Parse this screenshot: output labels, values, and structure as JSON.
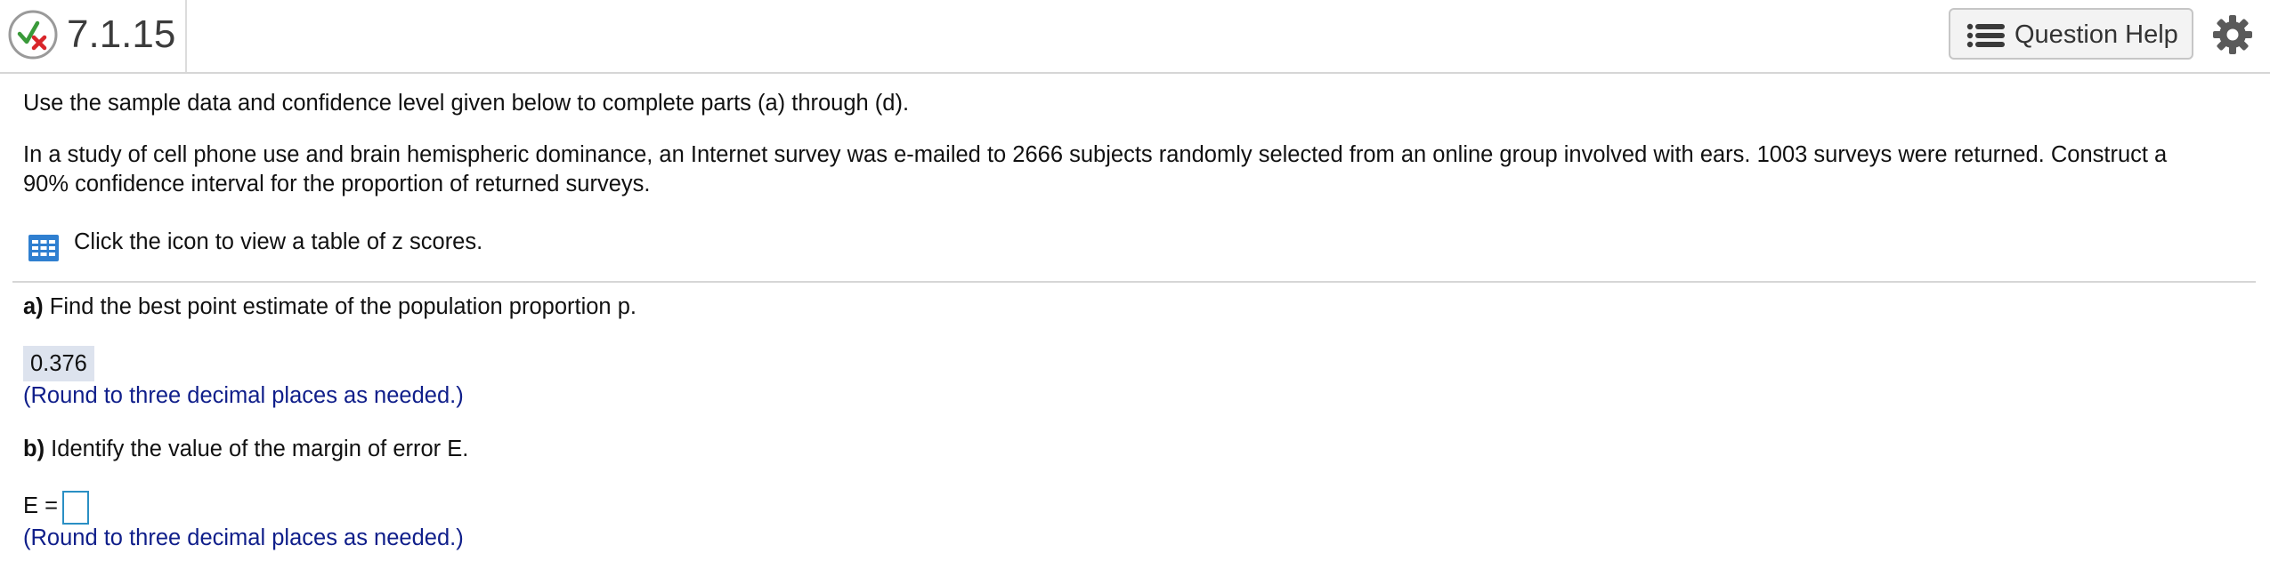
{
  "header": {
    "question_number": "7.1.15",
    "help_label": "Question Help",
    "icons": {
      "status": "partially-correct-icon",
      "help": "list-icon",
      "settings": "gear-icon"
    }
  },
  "question": {
    "intro": "Use the sample data and confidence level given below to complete parts (a) through (d).",
    "body_line1": "In a study of cell phone use and brain hemispheric dominance, an Internet survey was e-mailed to 2666 subjects randomly selected from an online group involved with ears. 1003 surveys were returned. Construct a",
    "body_line2": "90% confidence interval for the proportion of returned surveys.",
    "table_link": "Click the icon to view a table of z scores."
  },
  "part_a": {
    "label": "a)",
    "prompt": "Find the best point estimate of the population proportion p.",
    "answer": "0.376",
    "hint": "(Round to three decimal places as needed.)"
  },
  "part_b": {
    "label": "b)",
    "prompt": "Identify the value of the margin of error E.",
    "input_label": "E =",
    "input_value": "",
    "hint": "(Round to three decimal places as needed.)"
  },
  "colors": {
    "hint": "#0f1e8a",
    "input_border": "#2a8fc4",
    "answer_bg": "#dde3ee",
    "status_red": "#d9252a",
    "status_green": "#3a9a3a"
  }
}
